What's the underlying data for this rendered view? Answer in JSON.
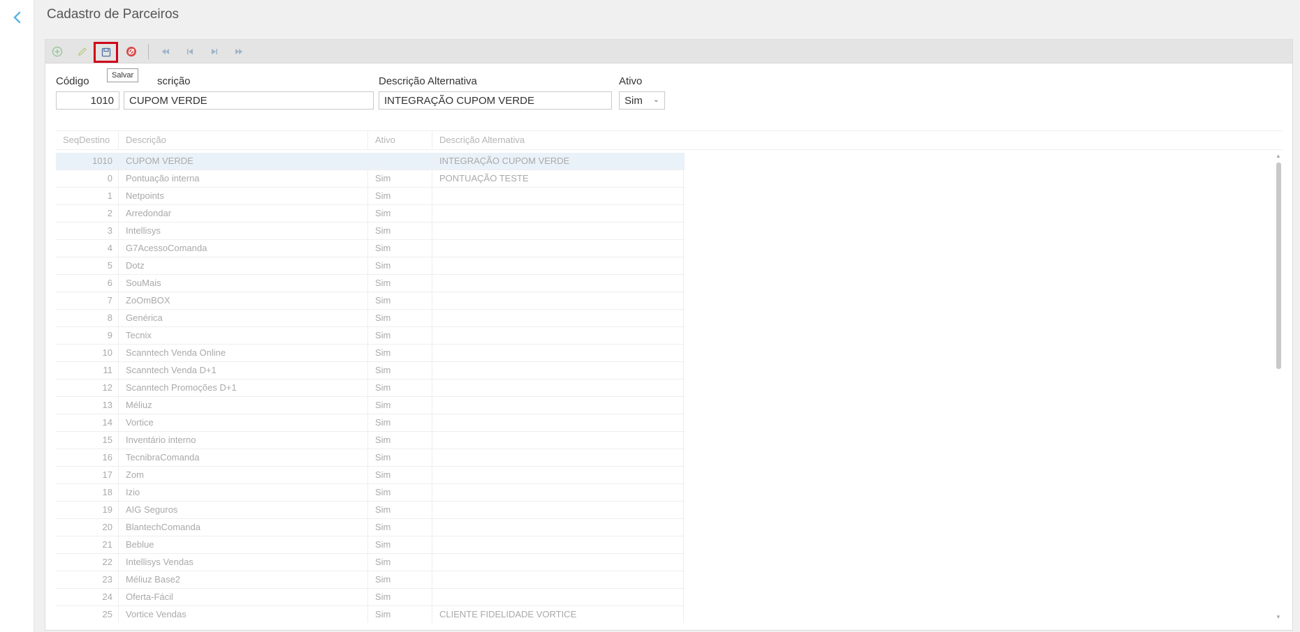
{
  "page": {
    "title": "Cadastro de Parceiros"
  },
  "toolbar": {
    "tooltip": "Salvar",
    "icons": [
      "add-icon",
      "edit-icon",
      "save-icon",
      "cancel-icon",
      "first-icon",
      "previous-icon",
      "next-icon",
      "last-icon"
    ]
  },
  "form": {
    "codigo_label": "Código",
    "codigo_value": "1010",
    "descricao_label": "Descrição",
    "descricao_label_visible": "scrição",
    "descricao_value": "CUPOM VERDE",
    "desc_alt_label": "Descrição Alternativa",
    "desc_alt_value": "INTEGRAÇÃO CUPOM VERDE",
    "ativo_label": "Ativo",
    "ativo_value": "Sim"
  },
  "grid": {
    "headers": {
      "seq": "SeqDestino",
      "descricao": "Descrição",
      "ativo": "Ativo",
      "desc_alt": "Descrição Alternativa"
    },
    "rows": [
      {
        "seq": "1010",
        "descricao": "CUPOM VERDE",
        "ativo": "",
        "desc_alt": "INTEGRAÇÃO CUPOM VERDE",
        "selected": true
      },
      {
        "seq": "0",
        "descricao": "Pontuação interna",
        "ativo": "Sim",
        "desc_alt": "PONTUAÇÃO TESTE"
      },
      {
        "seq": "1",
        "descricao": "Netpoints",
        "ativo": "Sim",
        "desc_alt": ""
      },
      {
        "seq": "2",
        "descricao": "Arredondar",
        "ativo": "Sim",
        "desc_alt": ""
      },
      {
        "seq": "3",
        "descricao": "Intellisys",
        "ativo": "Sim",
        "desc_alt": ""
      },
      {
        "seq": "4",
        "descricao": "G7AcessoComanda",
        "ativo": "Sim",
        "desc_alt": ""
      },
      {
        "seq": "5",
        "descricao": "Dotz",
        "ativo": "Sim",
        "desc_alt": ""
      },
      {
        "seq": "6",
        "descricao": "SouMais",
        "ativo": "Sim",
        "desc_alt": ""
      },
      {
        "seq": "7",
        "descricao": "ZoOmBOX",
        "ativo": "Sim",
        "desc_alt": ""
      },
      {
        "seq": "8",
        "descricao": "Genérica",
        "ativo": "Sim",
        "desc_alt": ""
      },
      {
        "seq": "9",
        "descricao": "Tecnix",
        "ativo": "Sim",
        "desc_alt": ""
      },
      {
        "seq": "10",
        "descricao": "Scanntech Venda Online",
        "ativo": "Sim",
        "desc_alt": ""
      },
      {
        "seq": "11",
        "descricao": "Scanntech Venda D+1",
        "ativo": "Sim",
        "desc_alt": ""
      },
      {
        "seq": "12",
        "descricao": "Scanntech Promoções D+1",
        "ativo": "Sim",
        "desc_alt": ""
      },
      {
        "seq": "13",
        "descricao": "Méliuz",
        "ativo": "Sim",
        "desc_alt": ""
      },
      {
        "seq": "14",
        "descricao": "Vortice",
        "ativo": "Sim",
        "desc_alt": ""
      },
      {
        "seq": "15",
        "descricao": "Inventário interno",
        "ativo": "Sim",
        "desc_alt": ""
      },
      {
        "seq": "16",
        "descricao": "TecnibraComanda",
        "ativo": "Sim",
        "desc_alt": ""
      },
      {
        "seq": "17",
        "descricao": "Zom",
        "ativo": "Sim",
        "desc_alt": ""
      },
      {
        "seq": "18",
        "descricao": "Izio",
        "ativo": "Sim",
        "desc_alt": ""
      },
      {
        "seq": "19",
        "descricao": "AIG Seguros",
        "ativo": "Sim",
        "desc_alt": ""
      },
      {
        "seq": "20",
        "descricao": "BlantechComanda",
        "ativo": "Sim",
        "desc_alt": ""
      },
      {
        "seq": "21",
        "descricao": "Beblue",
        "ativo": "Sim",
        "desc_alt": ""
      },
      {
        "seq": "22",
        "descricao": "Intellisys Vendas",
        "ativo": "Sim",
        "desc_alt": ""
      },
      {
        "seq": "23",
        "descricao": "Méliuz Base2",
        "ativo": "Sim",
        "desc_alt": ""
      },
      {
        "seq": "24",
        "descricao": "Oferta-Fácil",
        "ativo": "Sim",
        "desc_alt": ""
      },
      {
        "seq": "25",
        "descricao": "Vortice Vendas",
        "ativo": "Sim",
        "desc_alt": "CLIENTE FIDELIDADE VORTICE"
      }
    ]
  },
  "colors": {
    "accent": "#5bb3e6",
    "highlight_border": "#d0021b",
    "selected_row": "#eaf2f9"
  }
}
